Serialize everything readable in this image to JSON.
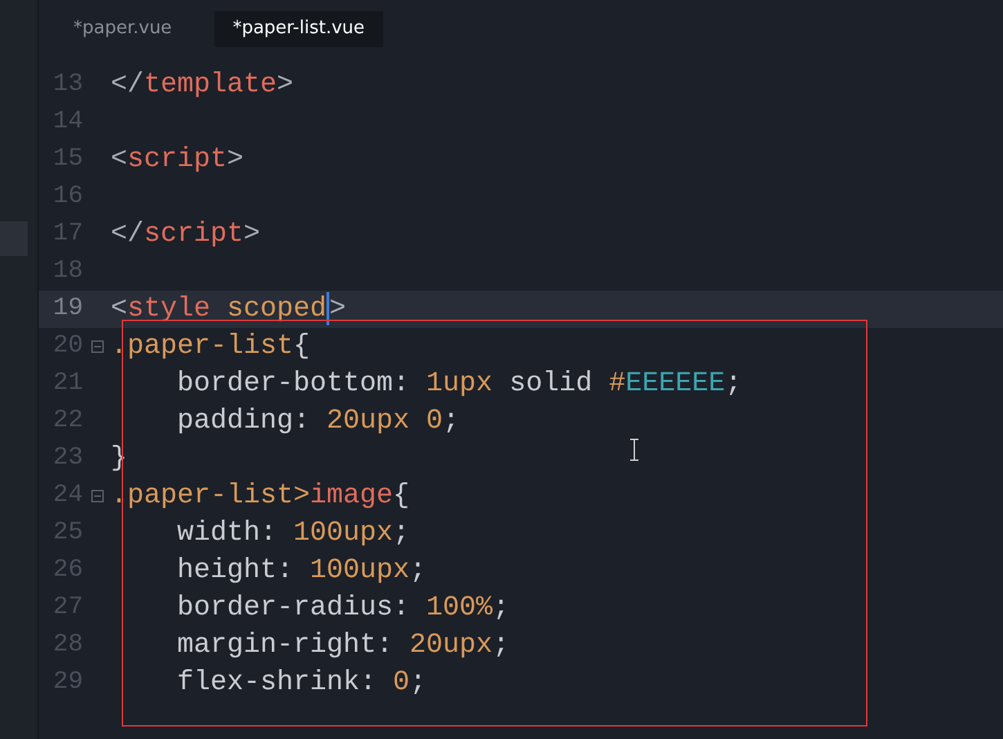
{
  "tabs": [
    {
      "label": "*paper.vue",
      "selected": false
    },
    {
      "label": "*paper-list.vue",
      "selected": true
    }
  ],
  "editor": {
    "lines": [
      {
        "number": "13",
        "current": false,
        "tokens": [
          {
            "kind": "punct",
            "text": "</"
          },
          {
            "kind": "tag",
            "text": "template"
          },
          {
            "kind": "punct",
            "text": ">"
          }
        ]
      },
      {
        "number": "14",
        "current": false
      },
      {
        "number": "15",
        "current": false,
        "tokens": [
          {
            "kind": "punct",
            "text": "<"
          },
          {
            "kind": "tag",
            "text": "script"
          },
          {
            "kind": "punct",
            "text": ">"
          }
        ]
      },
      {
        "number": "16",
        "current": false
      },
      {
        "number": "17",
        "current": false,
        "tokens": [
          {
            "kind": "punct",
            "text": "</"
          },
          {
            "kind": "tag",
            "text": "script"
          },
          {
            "kind": "punct",
            "text": ">"
          }
        ]
      },
      {
        "number": "18",
        "current": false
      },
      {
        "number": "19",
        "current": true,
        "tokens": [
          {
            "kind": "punct",
            "text": "<"
          },
          {
            "kind": "tag",
            "text": "style "
          },
          {
            "kind": "attr",
            "text": "scoped"
          },
          {
            "kind": "caret"
          },
          {
            "kind": "punct",
            "text": ">"
          }
        ]
      },
      {
        "number": "20",
        "current": false,
        "fold_expanded": true,
        "tokens": [
          {
            "kind": "selector",
            "text": ".paper-list"
          },
          {
            "kind": "plain",
            "text": "{"
          }
        ]
      },
      {
        "number": "21",
        "current": false,
        "tokens": [
          {
            "kind": "plain",
            "text": "    border-bottom: "
          },
          {
            "kind": "number",
            "text": "1upx"
          },
          {
            "kind": "plain",
            "text": " solid "
          },
          {
            "kind": "number",
            "text": "#"
          },
          {
            "kind": "hex",
            "text": "EEEEEE"
          },
          {
            "kind": "plain",
            "text": ";"
          }
        ]
      },
      {
        "number": "22",
        "current": false,
        "tokens": [
          {
            "kind": "plain",
            "text": "    padding: "
          },
          {
            "kind": "number",
            "text": "20upx 0"
          },
          {
            "kind": "plain",
            "text": ";"
          }
        ]
      },
      {
        "number": "23",
        "current": false,
        "tokens": [
          {
            "kind": "plain",
            "text": "}"
          }
        ]
      },
      {
        "number": "24",
        "current": false,
        "fold_expanded": true,
        "tokens": [
          {
            "kind": "selector",
            "text": ".paper-list>"
          },
          {
            "kind": "tag",
            "text": "image"
          },
          {
            "kind": "plain",
            "text": "{"
          }
        ]
      },
      {
        "number": "25",
        "current": false,
        "tokens": [
          {
            "kind": "plain",
            "text": "    width: "
          },
          {
            "kind": "number",
            "text": "100upx"
          },
          {
            "kind": "plain",
            "text": ";"
          }
        ]
      },
      {
        "number": "26",
        "current": false,
        "tokens": [
          {
            "kind": "plain",
            "text": "    height: "
          },
          {
            "kind": "number",
            "text": "100upx"
          },
          {
            "kind": "plain",
            "text": ";"
          }
        ]
      },
      {
        "number": "27",
        "current": false,
        "tokens": [
          {
            "kind": "plain",
            "text": "    border-radius: "
          },
          {
            "kind": "number",
            "text": "100%"
          },
          {
            "kind": "plain",
            "text": ";"
          }
        ]
      },
      {
        "number": "28",
        "current": false,
        "tokens": [
          {
            "kind": "plain",
            "text": "    margin-right: "
          },
          {
            "kind": "number",
            "text": "20upx"
          },
          {
            "kind": "plain",
            "text": ";"
          }
        ]
      },
      {
        "number": "29",
        "current": false,
        "tokens": [
          {
            "kind": "plain",
            "text": "    flex-shrink: "
          },
          {
            "kind": "number",
            "text": "0"
          },
          {
            "kind": "plain",
            "text": ";"
          }
        ]
      }
    ]
  }
}
